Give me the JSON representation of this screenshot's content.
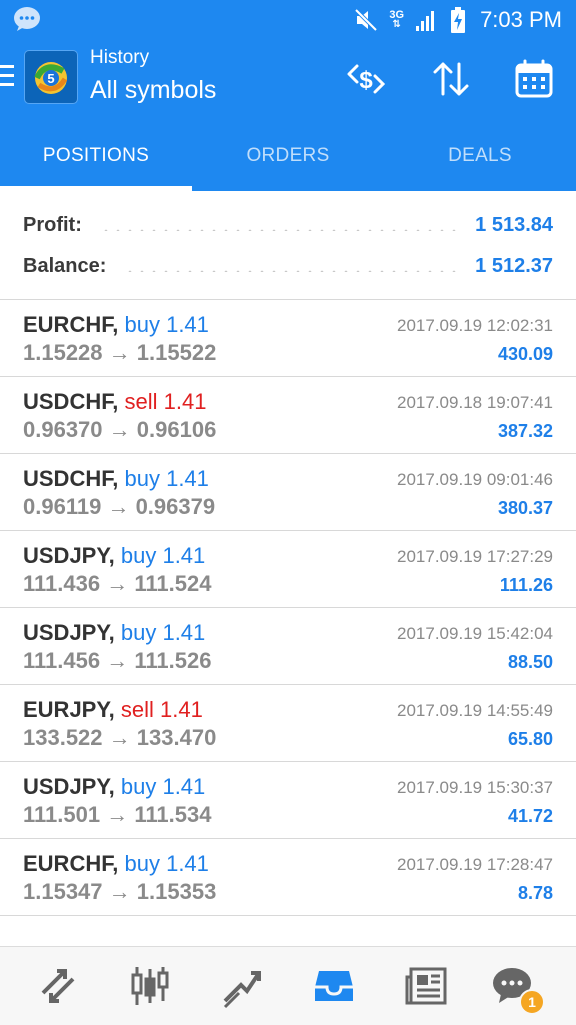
{
  "status_bar": {
    "time": "7:03 PM",
    "network": "3G"
  },
  "header": {
    "subtitle": "History",
    "title": "All symbols"
  },
  "tabs": [
    {
      "label": "POSITIONS",
      "active": true
    },
    {
      "label": "ORDERS",
      "active": false
    },
    {
      "label": "DEALS",
      "active": false
    }
  ],
  "summary": {
    "profit_label": "Profit:",
    "profit_value": "1 513.84",
    "balance_label": "Balance:",
    "balance_value": "1 512.37"
  },
  "positions": [
    {
      "symbol": "EURCHF,",
      "side": "buy",
      "volume": "1.41",
      "open": "1.15228",
      "close": "1.15522",
      "datetime": "2017.09.19 12:02:31",
      "profit": "430.09"
    },
    {
      "symbol": "USDCHF,",
      "side": "sell",
      "volume": "1.41",
      "open": "0.96370",
      "close": "0.96106",
      "datetime": "2017.09.18 19:07:41",
      "profit": "387.32"
    },
    {
      "symbol": "USDCHF,",
      "side": "buy",
      "volume": "1.41",
      "open": "0.96119",
      "close": "0.96379",
      "datetime": "2017.09.19 09:01:46",
      "profit": "380.37"
    },
    {
      "symbol": "USDJPY,",
      "side": "buy",
      "volume": "1.41",
      "open": "111.436",
      "close": "111.524",
      "datetime": "2017.09.19 17:27:29",
      "profit": "111.26"
    },
    {
      "symbol": "USDJPY,",
      "side": "buy",
      "volume": "1.41",
      "open": "111.456",
      "close": "111.526",
      "datetime": "2017.09.19 15:42:04",
      "profit": "88.50"
    },
    {
      "symbol": "EURJPY,",
      "side": "sell",
      "volume": "1.41",
      "open": "133.522",
      "close": "133.470",
      "datetime": "2017.09.19 14:55:49",
      "profit": "65.80"
    },
    {
      "symbol": "USDJPY,",
      "side": "buy",
      "volume": "1.41",
      "open": "111.501",
      "close": "111.534",
      "datetime": "2017.09.19 15:30:37",
      "profit": "41.72"
    },
    {
      "symbol": "EURCHF,",
      "side": "buy",
      "volume": "1.41",
      "open": "1.15347",
      "close": "1.15353",
      "datetime": "2017.09.19 17:28:47",
      "profit": "8.78"
    }
  ],
  "bottom_nav": {
    "chat_badge": "1"
  },
  "colors": {
    "primary": "#1e88f0",
    "buy": "#1e7fe8",
    "sell": "#e02020",
    "badge": "#f5a623"
  }
}
